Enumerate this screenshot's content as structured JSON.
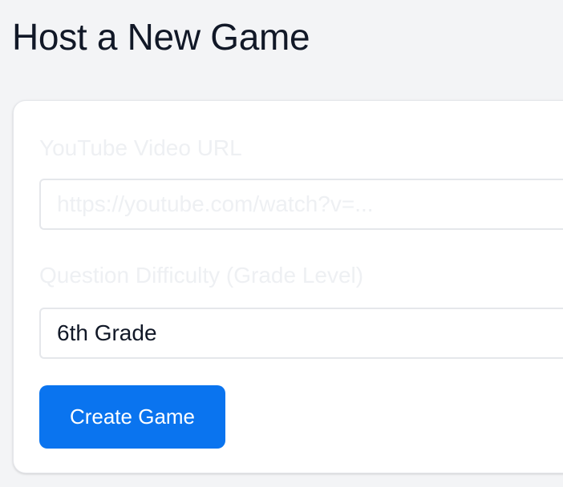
{
  "page": {
    "title": "Host a New Game"
  },
  "form": {
    "url_field": {
      "label": "YouTube Video URL",
      "placeholder": "https://youtube.com/watch?v=...",
      "value": ""
    },
    "difficulty_field": {
      "label": "Question Difficulty (Grade Level)",
      "selected": "6th Grade"
    },
    "submit_label": "Create Game"
  },
  "colors": {
    "background": "#f3f4f6",
    "card": "#ffffff",
    "primary_button": "#0a74ef",
    "title_text": "#111827",
    "faded_text": "#eef0f3"
  }
}
